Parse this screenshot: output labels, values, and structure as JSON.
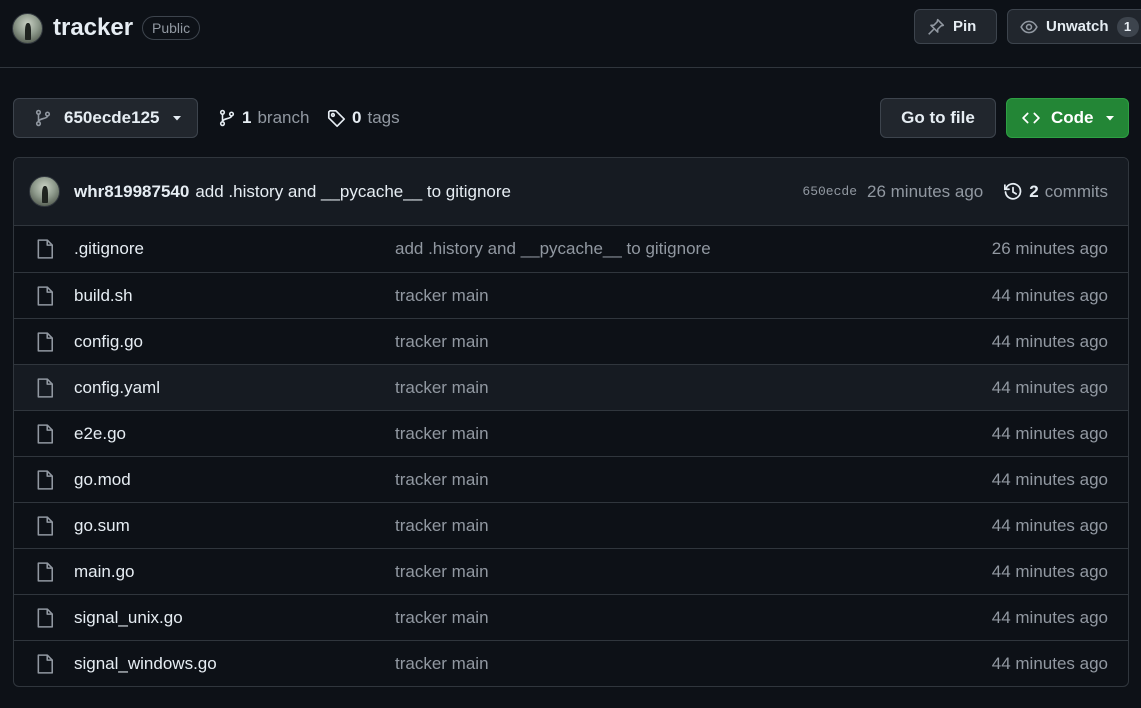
{
  "repo": {
    "name": "tracker",
    "visibility": "Public",
    "pin_label": "Pin",
    "watch_label": "Unwatch",
    "watch_count": "1"
  },
  "nav": {
    "branch_ref": "650ecde125",
    "branch_count": "1",
    "branch_label": "branch",
    "tag_count": "0",
    "tag_label": "tags",
    "goto_label": "Go to file",
    "code_label": "Code"
  },
  "latest_commit": {
    "author": "whr819987540",
    "message": "add .history and __pycache__ to gitignore",
    "sha": "650ecde",
    "time": "26 minutes ago",
    "commit_count": "2",
    "commits_label": "commits"
  },
  "files": [
    {
      "name": ".gitignore",
      "commit": "add .history and __pycache__ to gitignore",
      "age": "26 minutes ago"
    },
    {
      "name": "build.sh",
      "commit": "tracker main",
      "age": "44 minutes ago"
    },
    {
      "name": "config.go",
      "commit": "tracker main",
      "age": "44 minutes ago"
    },
    {
      "name": "config.yaml",
      "commit": "tracker main",
      "age": "44 minutes ago"
    },
    {
      "name": "e2e.go",
      "commit": "tracker main",
      "age": "44 minutes ago"
    },
    {
      "name": "go.mod",
      "commit": "tracker main",
      "age": "44 minutes ago"
    },
    {
      "name": "go.sum",
      "commit": "tracker main",
      "age": "44 minutes ago"
    },
    {
      "name": "main.go",
      "commit": "tracker main",
      "age": "44 minutes ago"
    },
    {
      "name": "signal_unix.go",
      "commit": "tracker main",
      "age": "44 minutes ago"
    },
    {
      "name": "signal_windows.go",
      "commit": "tracker main",
      "age": "44 minutes ago"
    }
  ],
  "colors": {
    "background": "#0d1117",
    "border": "#30363d",
    "code_button": "#238636",
    "muted_text": "#9198a1"
  },
  "icons": [
    "pin-icon",
    "eye-icon",
    "git-branch-icon",
    "caret-down-icon",
    "tag-icon",
    "code-icon",
    "history-icon",
    "file-icon"
  ]
}
